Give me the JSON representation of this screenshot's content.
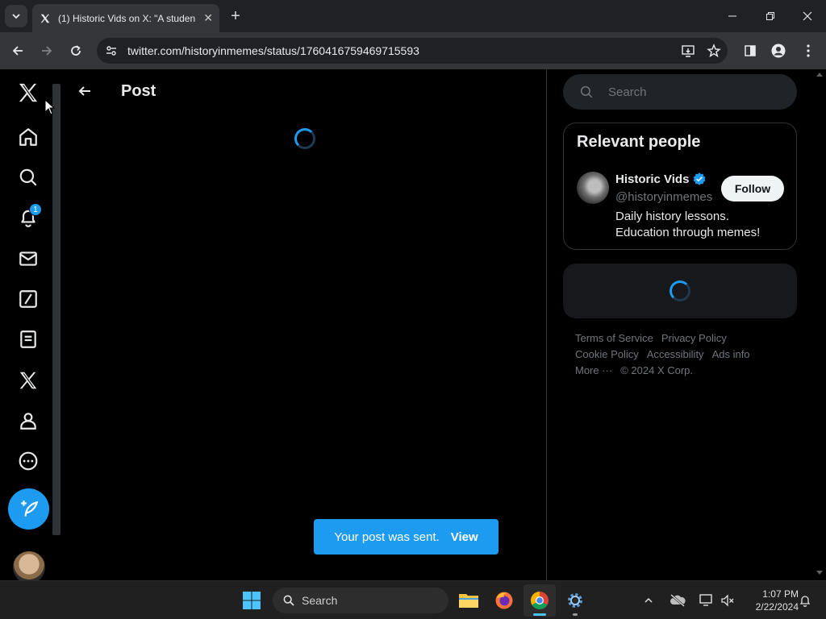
{
  "browser": {
    "tab_title": "(1) Historic Vids on X: \"A studen",
    "url": "twitter.com/historyinmemes/status/1760416759469715593"
  },
  "sidebar": {
    "notification_count": "1",
    "items": [
      {
        "icon": "x-logo-icon"
      },
      {
        "icon": "home-icon"
      },
      {
        "icon": "search-icon"
      },
      {
        "icon": "notifications-icon"
      },
      {
        "icon": "messages-icon"
      },
      {
        "icon": "grok-icon"
      },
      {
        "icon": "lists-icon"
      },
      {
        "icon": "premium-icon"
      },
      {
        "icon": "profile-icon"
      },
      {
        "icon": "more-icon"
      },
      {
        "icon": "post-compose-icon"
      }
    ]
  },
  "main": {
    "back_label": "←",
    "header_title": "Post"
  },
  "right": {
    "search_placeholder": "Search",
    "relevant_title": "Relevant people",
    "person": {
      "name": "Historic Vids",
      "handle": "@historyinmemes",
      "bio_line1": "Daily history lessons.",
      "bio_line2": "Education through memes!",
      "follow_label": "Follow"
    },
    "footer": {
      "terms": "Terms of Service",
      "privacy": "Privacy Policy",
      "cookie": "Cookie Policy",
      "accessibility": "Accessibility",
      "ads": "Ads info",
      "more": "More ···",
      "copyright": "© 2024 X Corp."
    }
  },
  "toast": {
    "message": "Your post was sent.",
    "action": "View"
  },
  "taskbar": {
    "search_label": "Search",
    "time": "1:07 PM",
    "date": "2/22/2024"
  },
  "colors": {
    "accent": "#1d9bf0",
    "background": "#000000",
    "border": "#2f3336"
  }
}
